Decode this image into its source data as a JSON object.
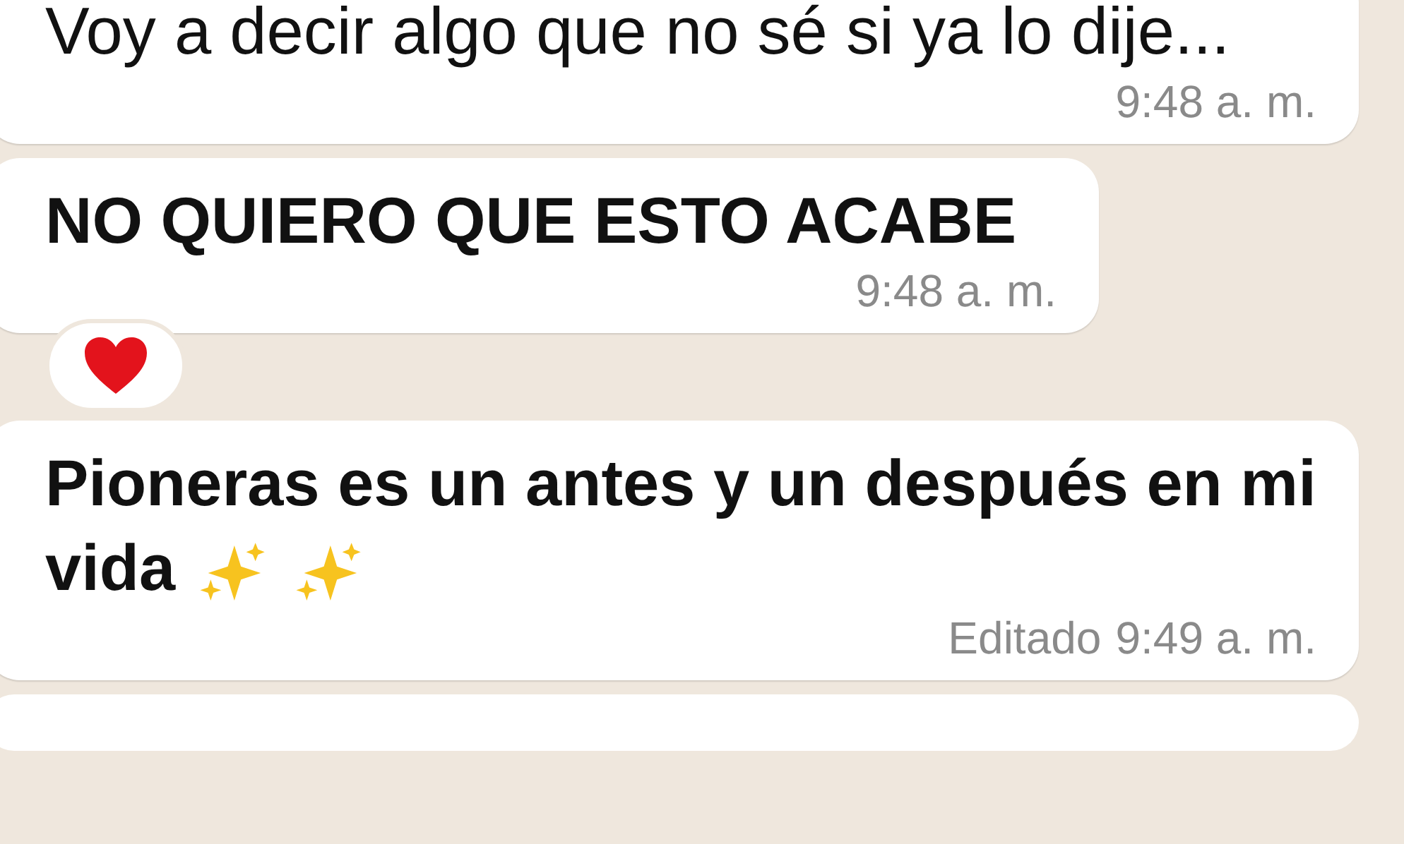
{
  "messages": [
    {
      "text": "Voy a decir algo que no sé si ya lo dije...",
      "bold": false,
      "time": "9:48",
      "meridiem": "a. m."
    },
    {
      "text": "NO QUIERO QUE ESTO ACABE",
      "bold": true,
      "time": "9:48",
      "meridiem": "a. m.",
      "reaction": {
        "kind": "heart"
      }
    },
    {
      "text": "Pioneras es un antes y un después en mi vida",
      "bold": true,
      "edited_label": "Editado",
      "time": "9:49",
      "meridiem": "a. m.",
      "trailing_icons": [
        {
          "kind": "sparkles"
        },
        {
          "kind": "sparkles"
        }
      ]
    }
  ]
}
